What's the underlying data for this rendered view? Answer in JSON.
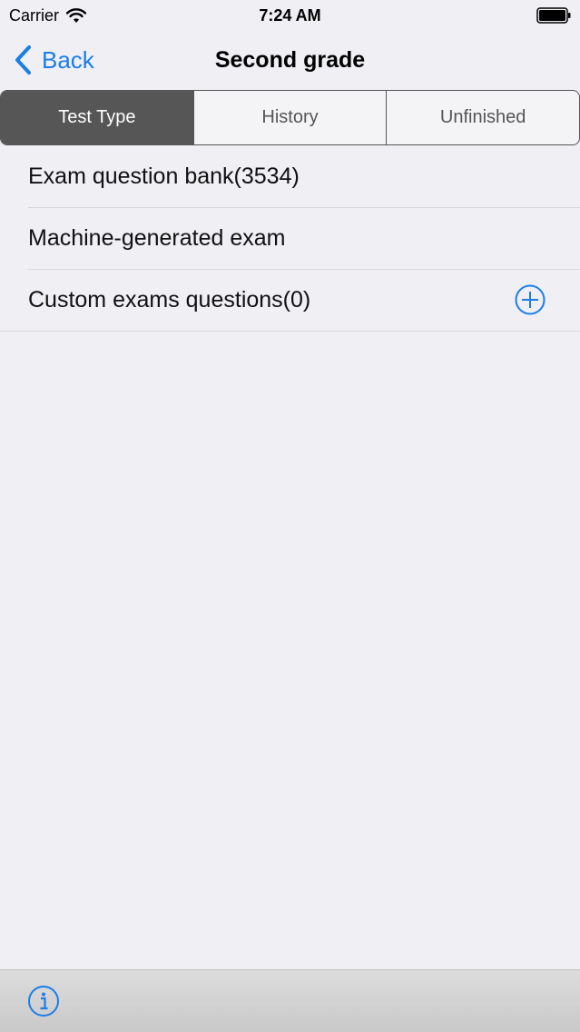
{
  "status_bar": {
    "carrier": "Carrier",
    "time": "7:24 AM",
    "wifi_icon": "wifi-icon",
    "battery_icon": "battery-icon"
  },
  "nav": {
    "back_label": "Back",
    "back_icon": "chevron-left-icon",
    "title": "Second grade"
  },
  "segments": [
    {
      "label": "Test Type",
      "selected": true
    },
    {
      "label": "History",
      "selected": false
    },
    {
      "label": "Unfinished",
      "selected": false
    }
  ],
  "list": {
    "items": [
      {
        "label": "Exam question bank(3534)"
      },
      {
        "label": "Machine-generated exam"
      },
      {
        "label": "Custom exams questions(0)",
        "accessory_icon": "plus-circle-icon"
      }
    ]
  },
  "toolbar": {
    "info_icon": "info-icon"
  },
  "colors": {
    "accent": "#1a7ee8",
    "background": "#efeff4",
    "segment_active": "#565656"
  }
}
